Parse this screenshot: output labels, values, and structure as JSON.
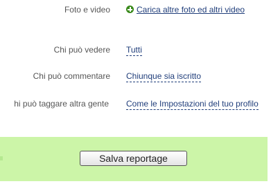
{
  "media": {
    "label": "Foto e video",
    "link": "Carica altre foto ed altri video",
    "icon": "plus-circle-icon"
  },
  "privacy": {
    "view": {
      "label": "Chi può vedere",
      "value": "Tutti"
    },
    "comment": {
      "label": "Chi può commentare",
      "value": "Chiunque sia iscritto"
    },
    "tag": {
      "label": "hi può taggare altra gente",
      "value": "Come le Impostazioni del tuo profilo"
    }
  },
  "actions": {
    "save_label": "Salva reportage"
  },
  "colors": {
    "link": "#1f3d7a",
    "label": "#555555",
    "save_bar": "#ccf5a8",
    "plus_icon": "#3a8a1c"
  }
}
